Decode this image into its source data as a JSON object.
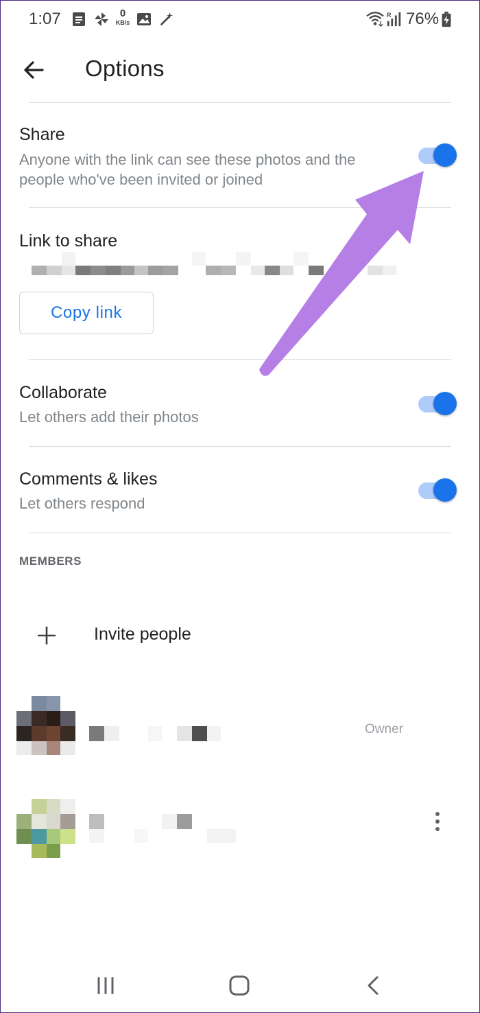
{
  "status_bar": {
    "time": "1:07",
    "network_speed_top": "0",
    "network_speed_unit": "KB/s",
    "battery": "76%",
    "icons": [
      "document-icon",
      "pinwheel-icon",
      "image-icon",
      "magic-wand-icon",
      "wifi-icon",
      "signal-icon",
      "battery-icon"
    ]
  },
  "header": {
    "title": "Options"
  },
  "share": {
    "title": "Share",
    "subtitle": "Anyone with the link can see these photos and the people who've been invited or joined",
    "enabled": true
  },
  "link": {
    "title": "Link to share",
    "copy_label": "Copy link"
  },
  "collaborate": {
    "title": "Collaborate",
    "subtitle": "Let others add their photos",
    "enabled": true
  },
  "comments": {
    "title": "Comments & likes",
    "subtitle": "Let others respond",
    "enabled": true
  },
  "members": {
    "label": "MEMBERS",
    "invite_label": "Invite people",
    "owner_role": "Owner"
  },
  "colors": {
    "accent": "#1a73e8",
    "toggle_track": "#aecbfa",
    "annotation_arrow": "#b57fe6"
  }
}
